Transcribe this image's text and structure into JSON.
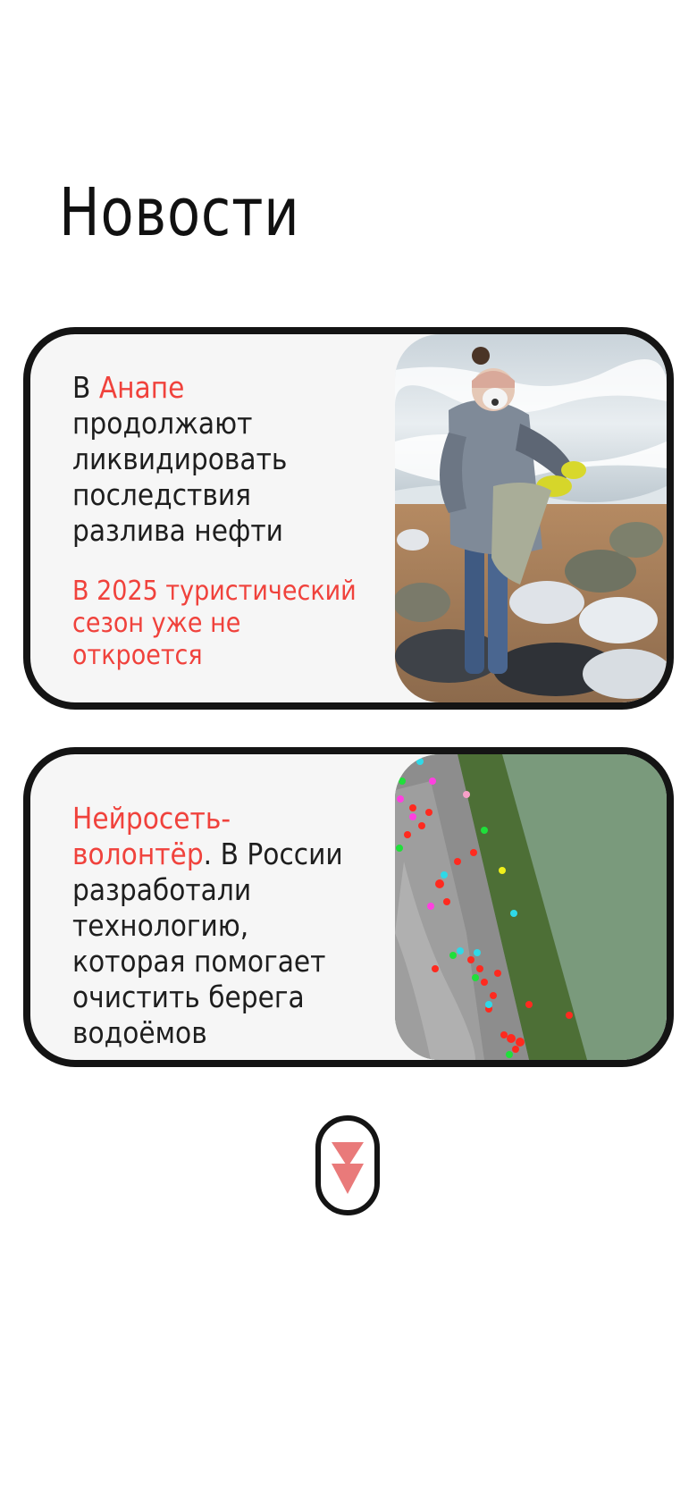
{
  "page": {
    "title": "Новости"
  },
  "news": [
    {
      "headline_before": "В ",
      "headline_accent": "Анапе",
      "headline_after": " продолжают ликвидировать последствия разлива нефти",
      "subheadline": "В 2025 туристический сезон уже не откроется",
      "image_icon": "volunteer-cleaning-beach-photo"
    },
    {
      "headline_accent": "Нейросеть-волонтёр",
      "headline_after": ". В России разработали технологию, которая помогает очистить берега водоёмов",
      "image_icon": "aerial-shoreline-detection-map"
    }
  ],
  "scroll_button": {
    "icon": "double-chevron-down-icon"
  },
  "colors": {
    "accent": "#f0423c",
    "border": "#141414",
    "card_background": "#f6f6f6",
    "arrow": "#e97a7a"
  }
}
